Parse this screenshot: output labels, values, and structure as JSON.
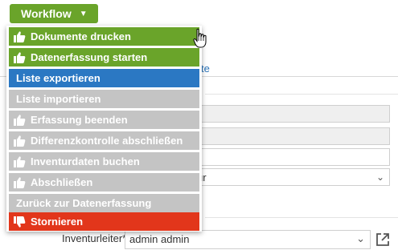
{
  "workflow_button": {
    "label": "Workflow"
  },
  "menu": {
    "items": [
      {
        "label": "Dokumente drucken",
        "style": "green",
        "icon": "thumbs-up-icon"
      },
      {
        "label": "Datenerfassung starten",
        "style": "green",
        "icon": "thumbs-up-icon"
      },
      {
        "label": "Liste exportieren",
        "style": "blue",
        "icon": ""
      },
      {
        "label": "Liste importieren",
        "style": "gray",
        "icon": ""
      },
      {
        "label": "Erfassung beenden",
        "style": "gray",
        "icon": "thumbs-up-icon"
      },
      {
        "label": "Differenzkontrolle abschließen",
        "style": "gray",
        "icon": "thumbs-up-icon"
      },
      {
        "label": "Inventurdaten buchen",
        "style": "gray",
        "icon": "thumbs-up-icon"
      },
      {
        "label": "Abschließen",
        "style": "gray",
        "icon": "thumbs-up-icon"
      },
      {
        "label": "Zurück zur Datenerfassung",
        "style": "gray",
        "icon": ""
      },
      {
        "label": "Stornieren",
        "style": "red",
        "icon": "thumbs-down-icon"
      }
    ]
  },
  "background": {
    "tab_fragment": "te",
    "select_fragment": "ur"
  },
  "inventory_manager": {
    "label": "Inventurleiter*",
    "value": "admin admin"
  },
  "colors": {
    "green": "#6aa42a",
    "blue": "#2b78c3",
    "gray": "#c4c4c4",
    "red": "#e2361b"
  }
}
